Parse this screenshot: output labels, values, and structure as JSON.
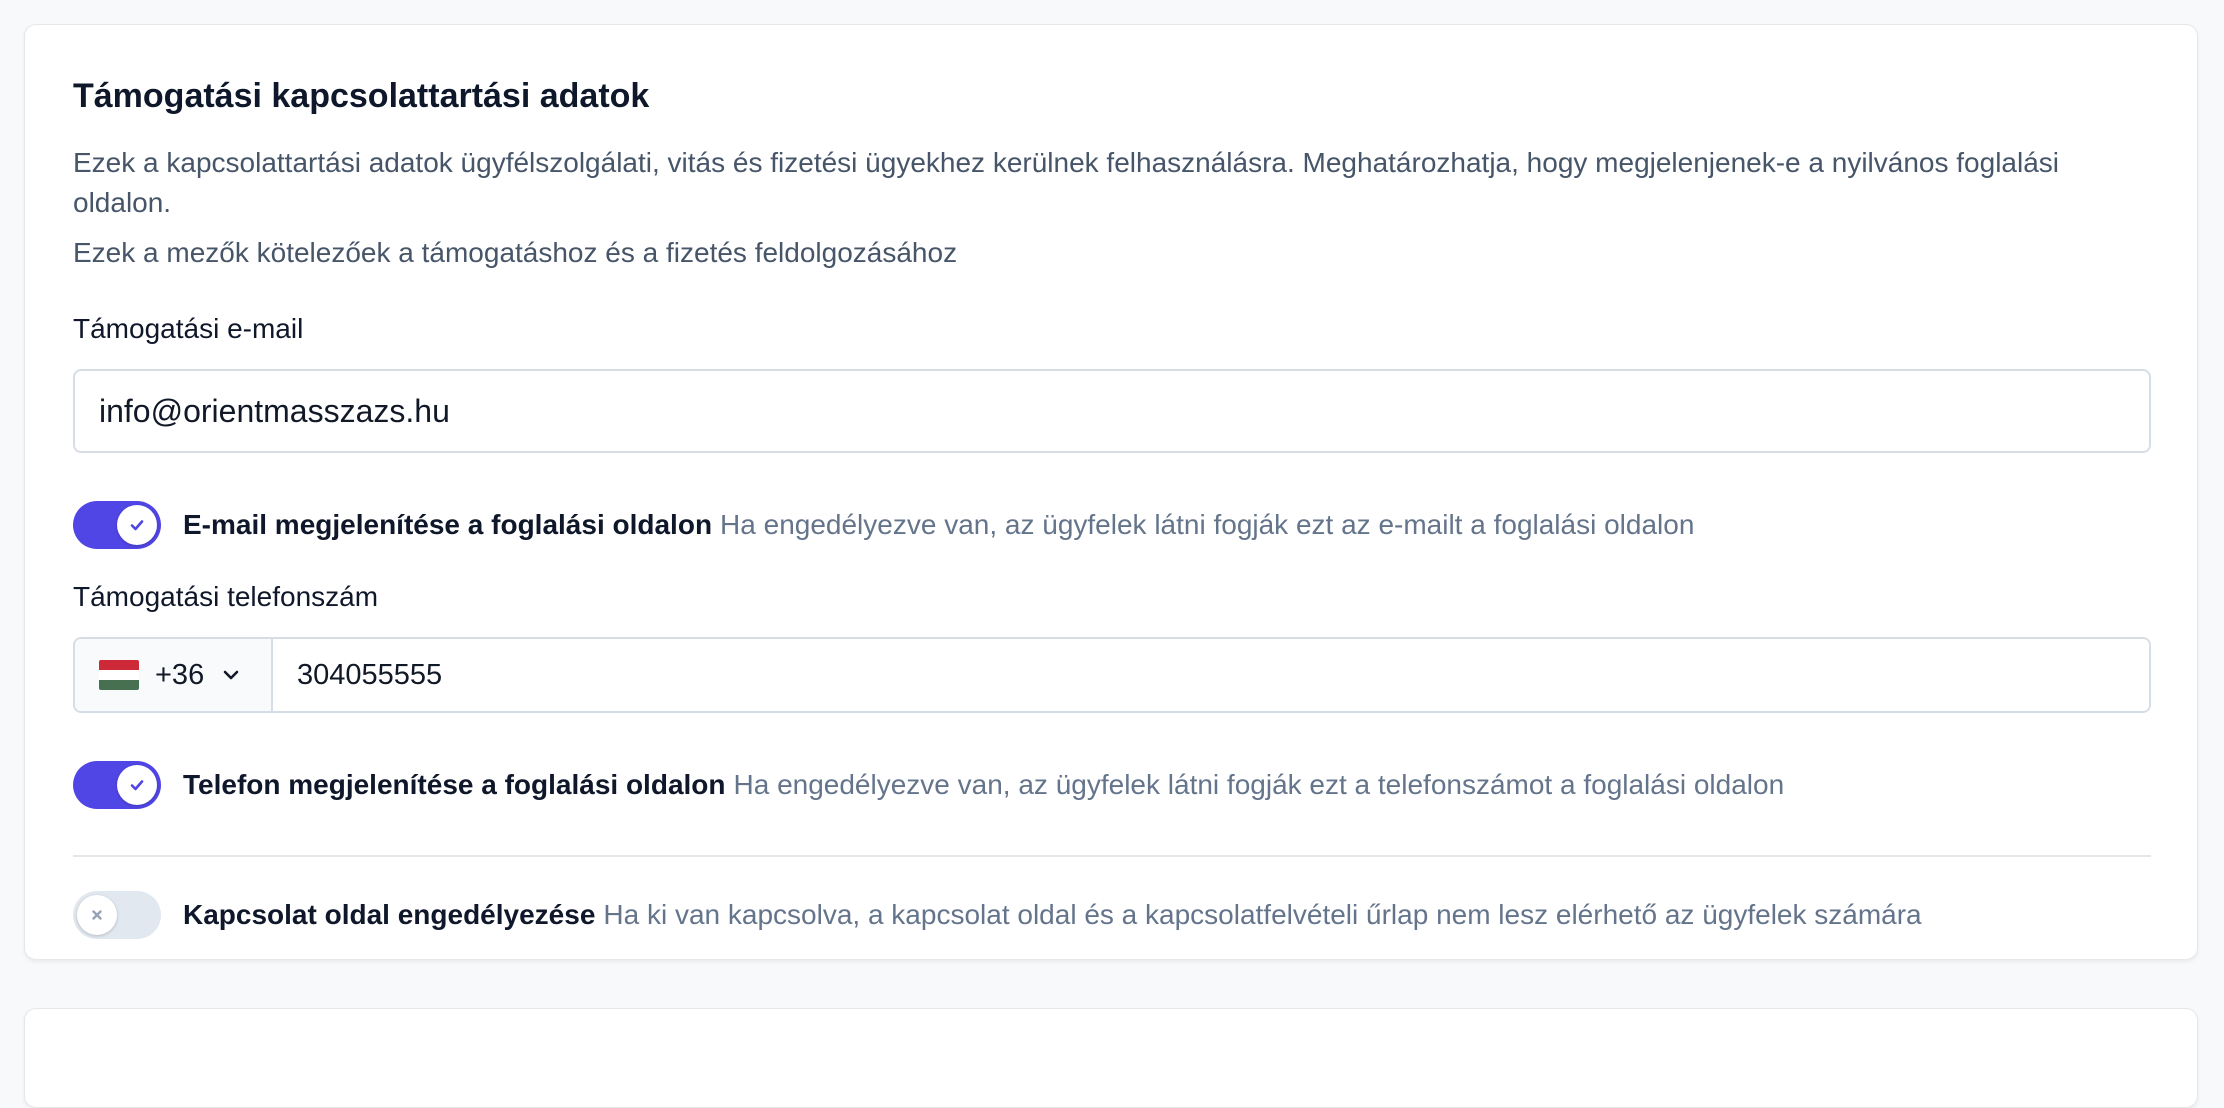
{
  "support": {
    "title": "Támogatási kapcsolattartási adatok",
    "description": "Ezek a kapcsolattartási adatok ügyfélszolgálati, vitás és fizetési ügyekhez kerülnek felhasználásra. Meghatározhatja, hogy megjelenjenek-e a nyilvános foglalási oldalon.",
    "required_note": "Ezek a mezők kötelezőek a támogatáshoz és a fizetés feldolgozásához",
    "email": {
      "label": "Támogatási e-mail",
      "value": "info@orientmasszazs.hu"
    },
    "email_toggle": {
      "enabled": true,
      "label": "E-mail megjelenítése a foglalási oldalon",
      "help": "Ha engedélyezve van, az ügyfelek látni fogják ezt az e-mailt a foglalási oldalon"
    },
    "phone": {
      "label": "Támogatási telefonszám",
      "country_flag": "hungary-flag",
      "dial_code": "+36",
      "value": "304055555"
    },
    "phone_toggle": {
      "enabled": true,
      "label": "Telefon megjelenítése a foglalási oldalon",
      "help": "Ha engedélyezve van, az ügyfelek látni fogják ezt a telefonszámot a foglalási oldalon"
    },
    "contact_page_toggle": {
      "enabled": false,
      "label": "Kapcsolat oldal engedélyezése",
      "help": "Ha ki van kapcsolva, a kapcsolat oldal és a kapcsolatfelvételi űrlap nem lesz elérhető az ügyfelek számára"
    }
  },
  "colors": {
    "accent": "#5046e5",
    "toggle_off": "#e2e8f0",
    "flag_red": "#ce2939",
    "flag_white": "#ffffff",
    "flag_green": "#477050"
  },
  "icons": {
    "toggle_on": "check-icon",
    "toggle_off": "x-icon",
    "country_dropdown": "chevron-down-icon"
  }
}
